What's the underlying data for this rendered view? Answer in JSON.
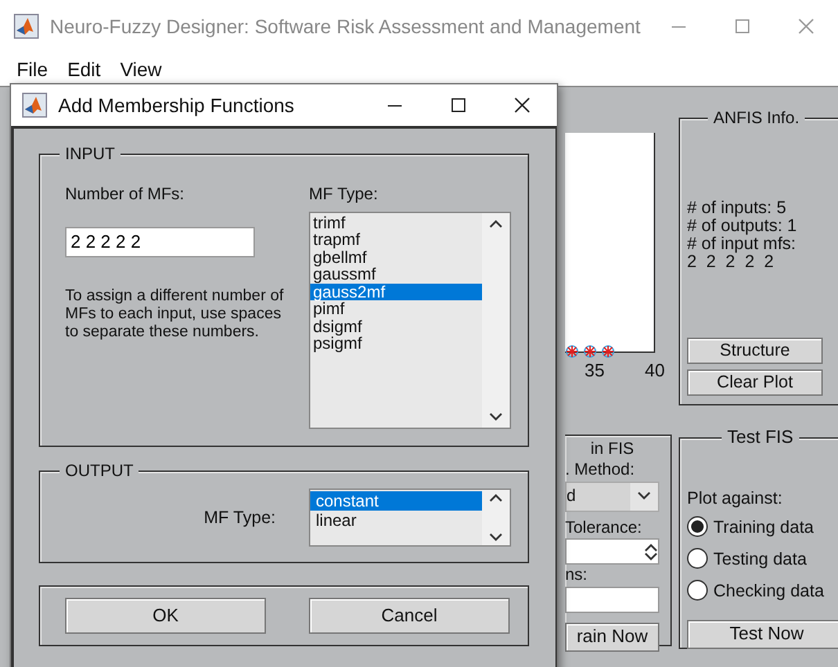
{
  "main_window": {
    "title": "Neuro-Fuzzy Designer: Software Risk Assessment and Management",
    "active": false,
    "menu": [
      "File",
      "Edit",
      "View"
    ],
    "plot": {
      "x_tick_labels": [
        "35",
        "40"
      ]
    },
    "anfis_info": {
      "title": "ANFIS Info.",
      "lines": [
        "# of inputs: 5",
        "# of outputs: 1",
        "# of input mfs:",
        "2  2  2  2  2"
      ],
      "buttons": [
        "Structure",
        "Clear Plot"
      ]
    },
    "train_fis": {
      "title": "in FIS",
      "method_label": ". Method:",
      "method_value": "d",
      "tolerance_label": "Tolerance:",
      "epochs_label": "ns:",
      "button": "rain Now"
    },
    "test_fis": {
      "title": "Test FIS",
      "plot_against_label": "Plot against:",
      "options": [
        {
          "label": "Training data",
          "selected": true
        },
        {
          "label": "Testing data",
          "selected": false
        },
        {
          "label": "Checking data",
          "selected": false
        }
      ],
      "button": "Test Now"
    }
  },
  "dialog": {
    "title": "Add Membership Functions",
    "active": true,
    "input": {
      "title": "INPUT",
      "mf_count_label": "Number of MFs:",
      "mf_count_value": "2 2 2 2 2",
      "help": "To assign a different number of MFs to each input, use spaces to separate these numbers.",
      "mf_type_label": "MF Type:",
      "mf_types": [
        {
          "label": "trimf",
          "selected": false
        },
        {
          "label": "trapmf",
          "selected": false
        },
        {
          "label": "gbellmf",
          "selected": false
        },
        {
          "label": "gaussmf",
          "selected": false
        },
        {
          "label": "gauss2mf",
          "selected": true
        },
        {
          "label": "pimf",
          "selected": false
        },
        {
          "label": "dsigmf",
          "selected": false
        },
        {
          "label": "psigmf",
          "selected": false
        }
      ]
    },
    "output": {
      "title": "OUTPUT",
      "mf_type_label": "MF Type:",
      "mf_types": [
        {
          "label": "constant",
          "selected": true
        },
        {
          "label": "linear",
          "selected": false
        }
      ]
    },
    "buttons": [
      "OK",
      "Cancel"
    ]
  }
}
